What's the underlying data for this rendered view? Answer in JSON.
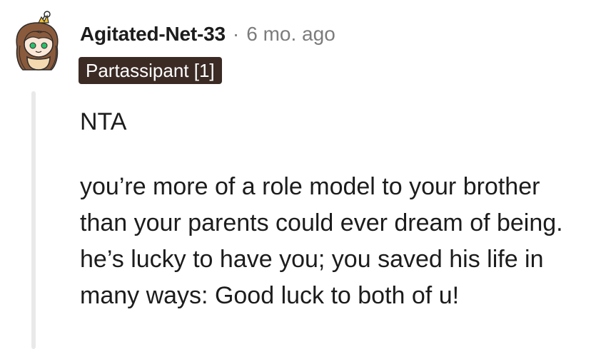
{
  "comment": {
    "author": "Agitated-Net-33",
    "separator": "·",
    "timestamp": "6 mo. ago",
    "flair": "Partassipant [1]",
    "paragraphs": [
      "NTA",
      "you’re more of a role model to your brother than your parents could ever dream of being. he’s lucky to have you; you saved his life in many ways: Good luck to both of u!"
    ]
  },
  "colors": {
    "flair_bg": "#3b2b24",
    "meta_text": "#7c7c7c",
    "thread_line": "#e9e9e9"
  },
  "icons": {
    "avatar": "snoo-avatar-icon"
  }
}
